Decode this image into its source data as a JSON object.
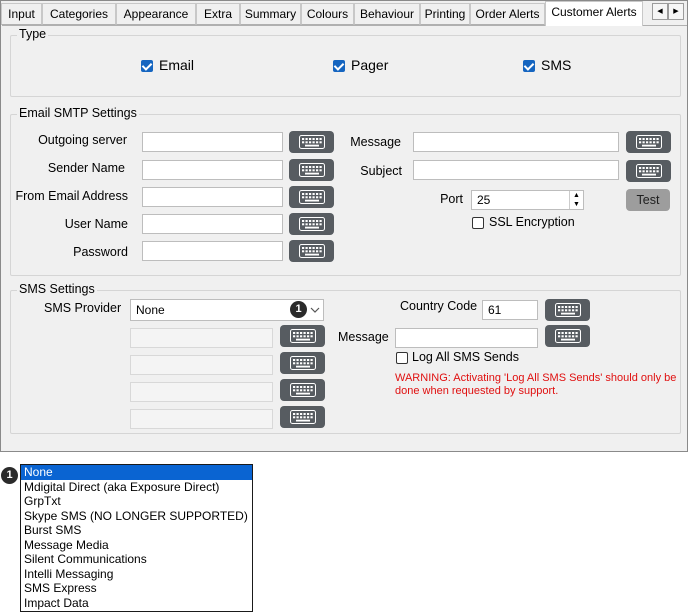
{
  "tabs": [
    {
      "label": "Input",
      "active": false
    },
    {
      "label": "Categories",
      "active": false
    },
    {
      "label": "Appearance",
      "active": false
    },
    {
      "label": "Extra",
      "active": false
    },
    {
      "label": "Summary",
      "active": false
    },
    {
      "label": "Colours",
      "active": false
    },
    {
      "label": "Behaviour",
      "active": false
    },
    {
      "label": "Printing",
      "active": false
    },
    {
      "label": "Order Alerts",
      "active": false
    },
    {
      "label": "Customer Alerts",
      "active": true
    }
  ],
  "type_group": {
    "title": "Type",
    "email": {
      "label": "Email",
      "checked": true
    },
    "pager": {
      "label": "Pager",
      "checked": true
    },
    "sms": {
      "label": "SMS",
      "checked": true
    }
  },
  "email_group": {
    "title": "Email SMTP Settings",
    "outgoing_server": {
      "label": "Outgoing server",
      "value": ""
    },
    "sender_name": {
      "label": "Sender Name",
      "value": ""
    },
    "from_email": {
      "label": "From Email Address",
      "value": ""
    },
    "user_name": {
      "label": "User Name",
      "value": ""
    },
    "password": {
      "label": "Password",
      "value": ""
    },
    "message": {
      "label": "Message",
      "value": ""
    },
    "subject": {
      "label": "Subject",
      "value": ""
    },
    "port": {
      "label": "Port",
      "value": "25"
    },
    "test_button": "Test",
    "ssl": {
      "label": "SSL Encryption",
      "checked": false
    }
  },
  "sms_group": {
    "title": "SMS Settings",
    "provider_label": "SMS Provider",
    "provider_value": "None",
    "country_code_label": "Country Code",
    "country_code_value": "61",
    "message_label": "Message",
    "message_value": "",
    "log_all": {
      "label": "Log All SMS Sends",
      "checked": false
    },
    "warning_line1": "WARNING: Activating 'Log All SMS Sends' should only be",
    "warning_line2": "done when requested by support.",
    "warning_color": "#e01010"
  },
  "callout_number": "1",
  "provider_options": [
    "None",
    "Mdigital Direct (aka Exposure Direct)",
    "GrpTxt",
    "Skype SMS (NO LONGER SUPPORTED)",
    "Burst SMS",
    "Message Media",
    "Silent Communications",
    "Intelli Messaging",
    "SMS Express",
    "Impact Data"
  ],
  "colors": {
    "selection": "#0a64d2",
    "keyboard_button": "#575c61",
    "checkbox": "#1565c0"
  }
}
